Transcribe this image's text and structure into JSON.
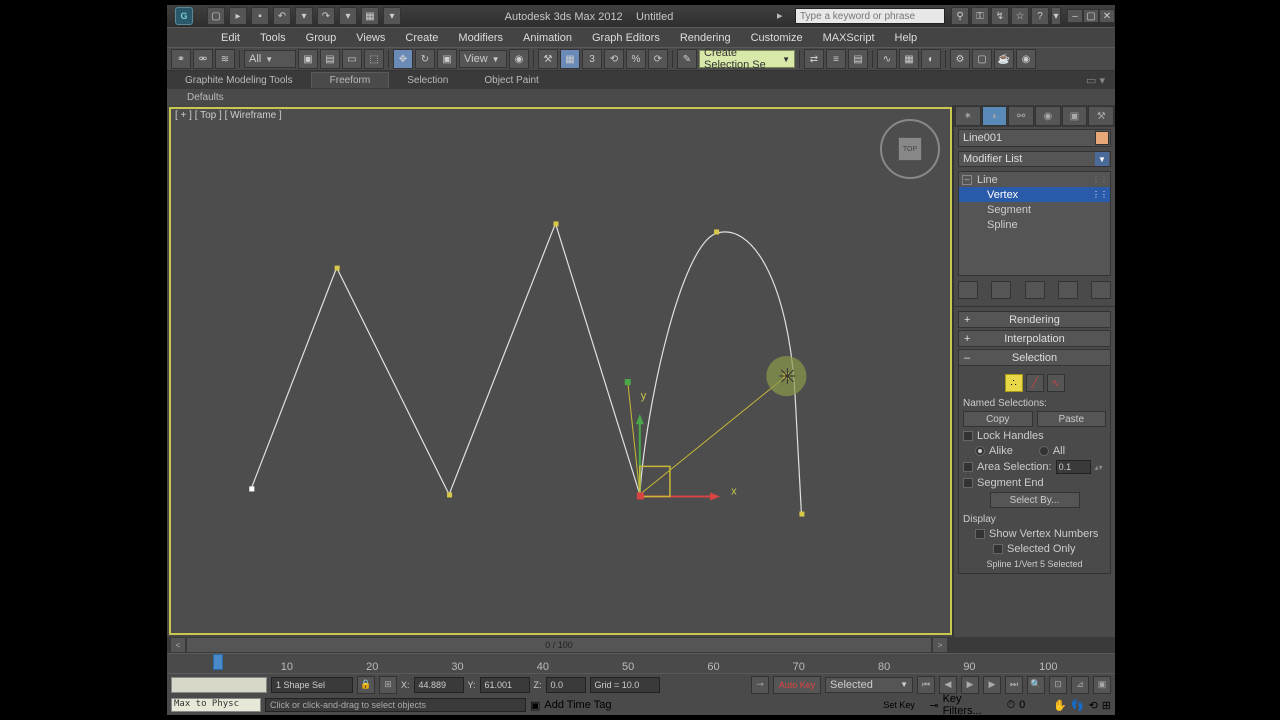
{
  "title": {
    "app": "Autodesk 3ds Max  2012",
    "doc": "Untitled"
  },
  "search_placeholder": "Type a keyword or phrase",
  "menus": [
    "Edit",
    "Tools",
    "Group",
    "Views",
    "Create",
    "Modifiers",
    "Animation",
    "Graph Editors",
    "Rendering",
    "Customize",
    "MAXScript",
    "Help"
  ],
  "toolbar": {
    "filter": "All",
    "refcoord": "View",
    "selset": "Create Selection Se"
  },
  "ribbon": {
    "tabs": [
      "Graphite Modeling Tools",
      "Freeform",
      "Selection",
      "Object Paint"
    ],
    "active": 1,
    "subtabs": [
      "Defaults"
    ]
  },
  "viewport": {
    "label": "[ + ] [ Top ] [ Wireframe ]",
    "viewcube_face": "TOP",
    "axis_y": "y",
    "axis_x": "x"
  },
  "modify": {
    "objname": "Line001",
    "modifier_list": "Modifier List",
    "stack": [
      {
        "label": "Line",
        "level": 0,
        "exp": "-"
      },
      {
        "label": "Vertex",
        "level": 1,
        "sel": true
      },
      {
        "label": "Segment",
        "level": 1
      },
      {
        "label": "Spline",
        "level": 1
      }
    ],
    "rollouts": {
      "rendering": "Rendering",
      "interpolation": "Interpolation",
      "selection": "Selection"
    },
    "named_sel": "Named Selections:",
    "copy": "Copy",
    "paste": "Paste",
    "lock_handles": "Lock Handles",
    "alike": "Alike",
    "all": "All",
    "area_sel": "Area Selection:",
    "area_val": "0.1",
    "segment_end": "Segment End",
    "select_by": "Select By...",
    "display": "Display",
    "show_vnum": "Show Vertex Numbers",
    "selected_only": "Selected Only",
    "status": "Spline 1/Vert 5 Selected"
  },
  "time": {
    "slider": "0 / 100",
    "ticks": [
      10,
      20,
      30,
      40,
      50,
      60,
      70,
      80,
      90,
      100
    ]
  },
  "status": {
    "shapes": "1 Shape Sel",
    "x": "44.889",
    "y": "61.001",
    "z": "0.0",
    "grid": "Grid = 10.0",
    "autokey": "Auto Key",
    "setkey": "Set Key",
    "keymode": "Selected",
    "keyfilters": "Key Filters...",
    "hint": "Click or click-and-drag to select objects",
    "addtag": "Add Time Tag",
    "maxphys": "Max to Physc",
    "framenum": "0"
  }
}
